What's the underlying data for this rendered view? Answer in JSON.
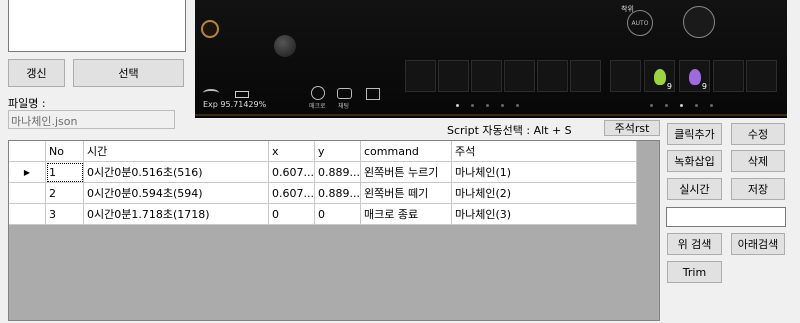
{
  "top_listbox": {},
  "buttons": {
    "refresh": "갱신",
    "select": "선택",
    "comment_rst": "주석rst",
    "click_add": "클릭추가",
    "edit": "수정",
    "record_insert": "녹화삽입",
    "delete": "삭제",
    "realtime": "실시간",
    "save": "저장",
    "search_up": "위 검색",
    "search_down": "아래검색",
    "trim": "Trim"
  },
  "file": {
    "label": "파일명 :",
    "value": "마나체인.json"
  },
  "script_auto_select": "Script 자동선택 : Alt + S",
  "search_box": {
    "value": ""
  },
  "game": {
    "exp": "Exp 95.71429%",
    "auto": "AUTO",
    "macro_label": "매크로",
    "chat_label": "채팅",
    "potion1_count": "9",
    "potion2_count": "9",
    "top_label": "착위"
  },
  "grid": {
    "columns": [
      "No",
      "시간",
      "x",
      "y",
      "command",
      "주석"
    ],
    "rows": [
      [
        "1",
        "0시간0분0.516초(516)",
        "0.607...",
        "0.889...",
        "왼쪽버튼 누르기",
        "마나체인(1)"
      ],
      [
        "2",
        "0시간0분0.594초(594)",
        "0.607...",
        "0.889...",
        "왼쪽버튼 떼기",
        "마나체인(2)"
      ],
      [
        "3",
        "0시간0분1.718초(1718)",
        "0",
        "0",
        "매크로 종료",
        "마나체인(3)"
      ]
    ],
    "current_row_marker": "▶"
  }
}
